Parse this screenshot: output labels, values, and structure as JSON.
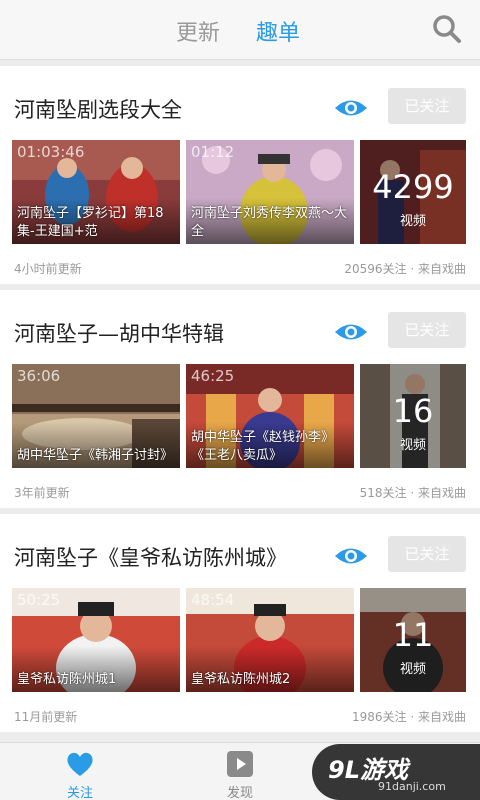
{
  "header": {
    "tabs": [
      {
        "label": "更新"
      },
      {
        "label": "趣单"
      }
    ]
  },
  "cards": [
    {
      "title": "河南坠剧选段大全",
      "follow_label": "已关注",
      "videos": [
        {
          "duration": "01:03:46",
          "caption": "河南坠子【罗衫记】第18集-王建国+范"
        },
        {
          "duration": "01:12",
          "caption": "河南坠子刘秀传李双燕～大全"
        }
      ],
      "count": "4299",
      "count_unit": "视频",
      "updated": "4小时前更新",
      "meta": "20596关注 · 来自戏曲"
    },
    {
      "title": "河南坠子—胡中华特辑",
      "follow_label": "已关注",
      "videos": [
        {
          "duration": "36:06",
          "caption": "胡中华坠子《韩湘子讨封》"
        },
        {
          "duration": "46:25",
          "caption": "胡中华坠子《赵钱孙李》《王老八卖瓜》"
        }
      ],
      "count": "16",
      "count_unit": "视频",
      "updated": "3年前更新",
      "meta": "518关注 · 来自戏曲"
    },
    {
      "title": "河南坠子《皇爷私访陈州城》",
      "follow_label": "已关注",
      "videos": [
        {
          "duration": "50:25",
          "caption": "皇爷私访陈州城1"
        },
        {
          "duration": "48:54",
          "caption": "皇爷私访陈州城2"
        }
      ],
      "count": "11",
      "count_unit": "视频",
      "updated": "11月前更新",
      "meta": "1986关注 · 来自戏曲"
    }
  ],
  "bottom_nav": [
    {
      "label": "关注",
      "icon": "heart-icon",
      "active": true
    },
    {
      "label": "发现",
      "icon": "play-icon",
      "active": false
    }
  ],
  "watermark": {
    "main": "9L游戏",
    "sub": "91danji.com"
  },
  "colors": {
    "accent": "#2a9be6",
    "follow_bg": "#e5e5e5"
  }
}
